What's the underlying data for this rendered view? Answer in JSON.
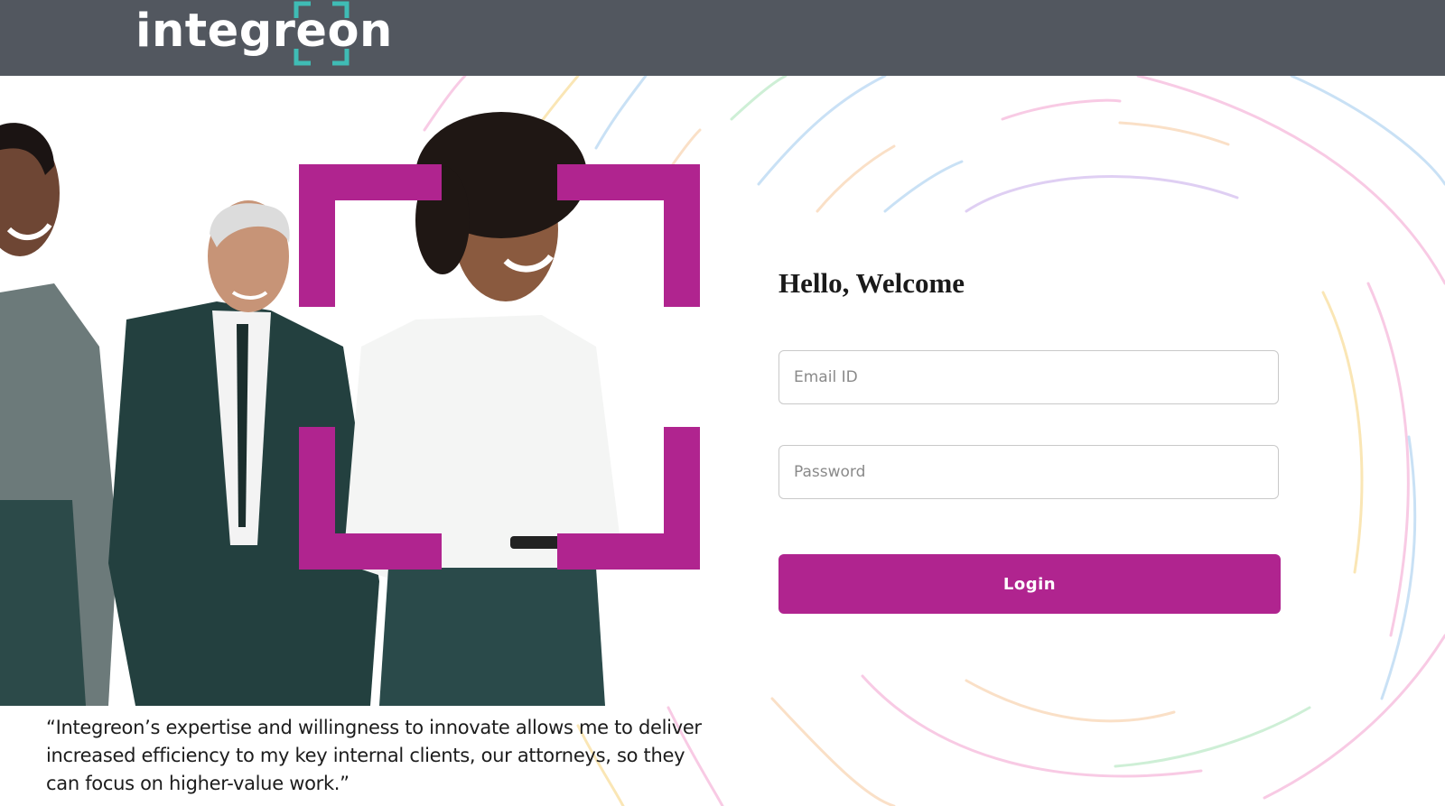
{
  "brand": {
    "name": "integreon"
  },
  "colors": {
    "topbar": "#52575f",
    "accent": "#b0248f",
    "logo_bracket": "#3fbcb5"
  },
  "login": {
    "heading": "Hello, Welcome",
    "email_placeholder": "Email ID",
    "password_placeholder": "Password",
    "button_label": "Login"
  },
  "hero": {
    "image": "three smiling business professionals walking, framed by magenta corner brackets",
    "quote": "“Integreon’s expertise and willingness to innovate allows me to deliver increased efficiency to my key internal clients, our attorneys, so they can focus on higher-value work.”"
  }
}
